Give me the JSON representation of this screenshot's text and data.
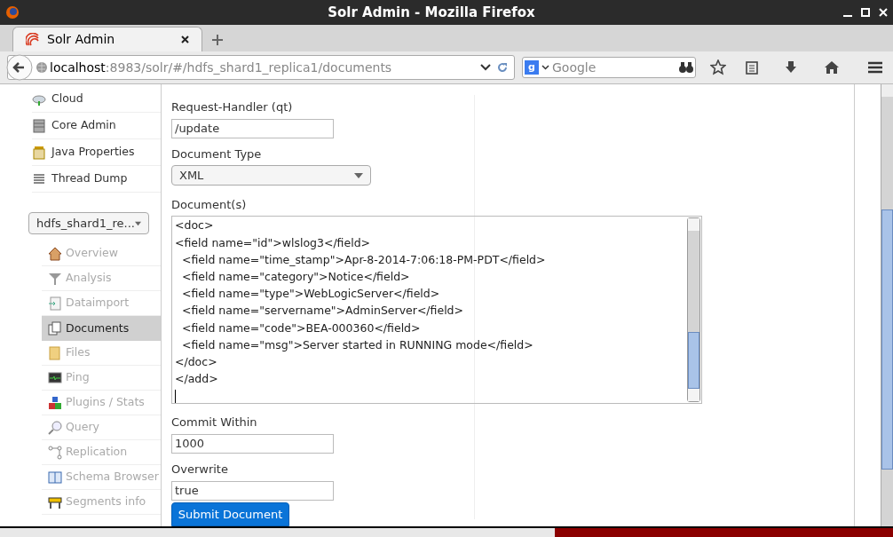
{
  "window": {
    "title": "Solr Admin - Mozilla Firefox"
  },
  "tabs": [
    {
      "label": "Solr Admin",
      "selected": true
    }
  ],
  "address_bar": {
    "host": "localhost",
    "path": ":8983/solr/#/hdfs_shard1_replica1/documents"
  },
  "search": {
    "engine_glyph": "g",
    "placeholder": "Google"
  },
  "sidebar": {
    "global_items": [
      {
        "label": "Cloud",
        "kind": "cloud"
      },
      {
        "label": "Core Admin",
        "kind": "server"
      },
      {
        "label": "Java Properties",
        "kind": "jar"
      },
      {
        "label": "Thread Dump",
        "kind": "stack"
      }
    ],
    "core_selector": {
      "value": "hdfs_shard1_re..."
    },
    "core_items": [
      {
        "label": "Overview",
        "kind": "house",
        "selected": false
      },
      {
        "label": "Analysis",
        "kind": "funnel",
        "selected": false
      },
      {
        "label": "Dataimport",
        "kind": "import",
        "selected": false
      },
      {
        "label": "Documents",
        "kind": "docs",
        "selected": true
      },
      {
        "label": "Files",
        "kind": "folder",
        "selected": false
      },
      {
        "label": "Ping",
        "kind": "monitor",
        "selected": false
      },
      {
        "label": "Plugins / Stats",
        "kind": "blocks",
        "selected": false
      },
      {
        "label": "Query",
        "kind": "magnifier",
        "selected": false
      },
      {
        "label": "Replication",
        "kind": "nodes",
        "selected": false
      },
      {
        "label": "Schema Browser",
        "kind": "book",
        "selected": false
      },
      {
        "label": "Segments info",
        "kind": "barrier",
        "selected": false
      }
    ]
  },
  "form": {
    "request_handler": {
      "label": "Request-Handler (qt)",
      "value": "/update"
    },
    "document_type": {
      "label": "Document Type",
      "value": "XML"
    },
    "documents": {
      "label": "Document(s)",
      "lines": [
        "<doc>",
        "<field name=\"id\">wlslog3</field>",
        "  <field name=\"time_stamp\">Apr-8-2014-7:06:18-PM-PDT</field>",
        "  <field name=\"category\">Notice</field>",
        "  <field name=\"type\">WebLogicServer</field>",
        "  <field name=\"servername\">AdminServer</field>",
        "  <field name=\"code\">BEA-000360</field>",
        "  <field name=\"msg\">Server started in RUNNING mode</field>",
        "</doc>",
        "</add>"
      ]
    },
    "commit_within": {
      "label": "Commit Within",
      "value": "1000"
    },
    "overwrite": {
      "label": "Overwrite",
      "value": "true"
    },
    "submit": {
      "label": "Submit Document"
    }
  }
}
